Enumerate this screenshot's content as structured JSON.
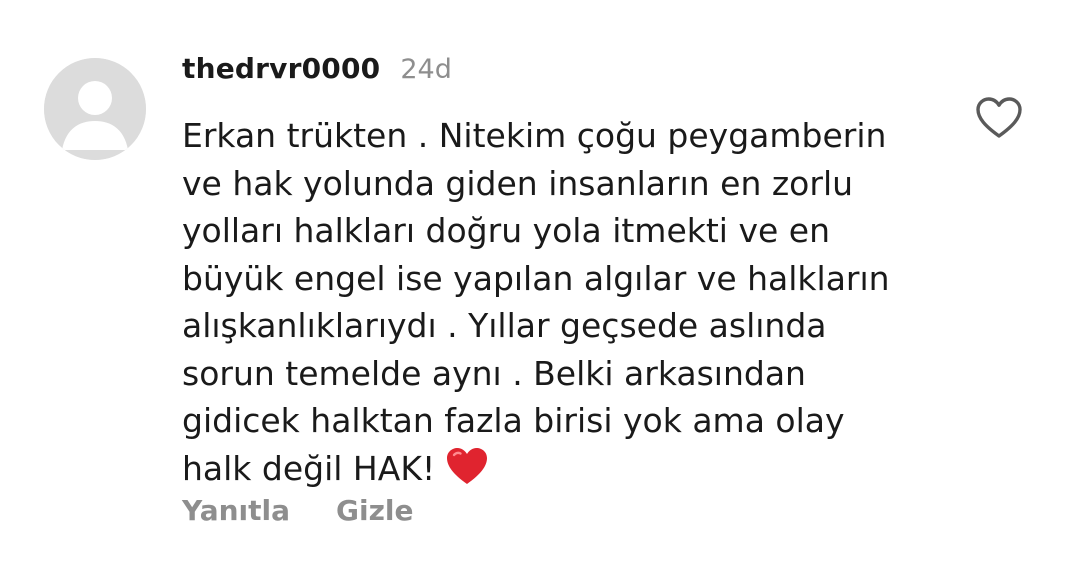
{
  "comment": {
    "username": "thedrvr0000",
    "timestamp": "24d",
    "lines": [
      "Erkan trükten . Nitekim çoğu peygamberin",
      "ve hak yolunda giden insanların en zorlu",
      "yolları halkları doğru yola itmekti ve en",
      "büyük engel ise yapılan algılar ve halkların",
      "alışkanlıklarıydı . Yıllar geçsede aslında",
      "sorun temelde aynı . Belki arkasından",
      "gidicek halktan fazla birisi yok ama olay",
      "halk değil HAK!"
    ],
    "end_emoji": "red-heart-emoji",
    "like_icon": "heart-outline-icon",
    "avatar_icon": "default-avatar-icon"
  },
  "actions": {
    "reply_label": "Yanıtla",
    "hide_label": "Gizle"
  },
  "colors": {
    "text": "#1a1a1a",
    "muted": "#8e8e8e",
    "avatar_bg": "#dcdcdc",
    "avatar_fg": "#ffffff",
    "heart_red": "#e0242f"
  }
}
